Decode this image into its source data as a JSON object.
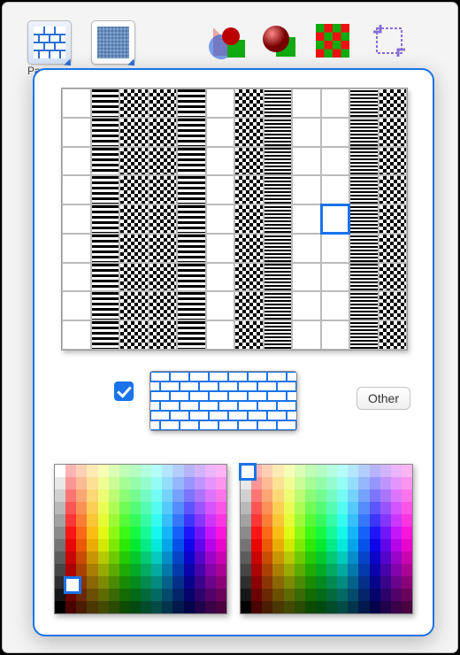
{
  "toolbar": {
    "patternLabel": "Pa",
    "tools": [
      "pattern-fill",
      "texture-fill",
      "shape-combine",
      "3d-sphere",
      "checkerboard",
      "crop"
    ]
  },
  "popover": {
    "otherLabel": "Other",
    "usePatternChecked": true,
    "patternGrid": {
      "cols": 12,
      "rows": 9,
      "selectedIndex": 57
    },
    "foregroundPalette": {
      "selected": {
        "col": 1,
        "row": 9,
        "hex": "#1a73e8"
      }
    },
    "backgroundPalette": {
      "selected": {
        "col": 0,
        "row": 0,
        "hex": "#ffffff"
      }
    },
    "paletteGrid": {
      "cols": 16,
      "rows": 12
    }
  }
}
